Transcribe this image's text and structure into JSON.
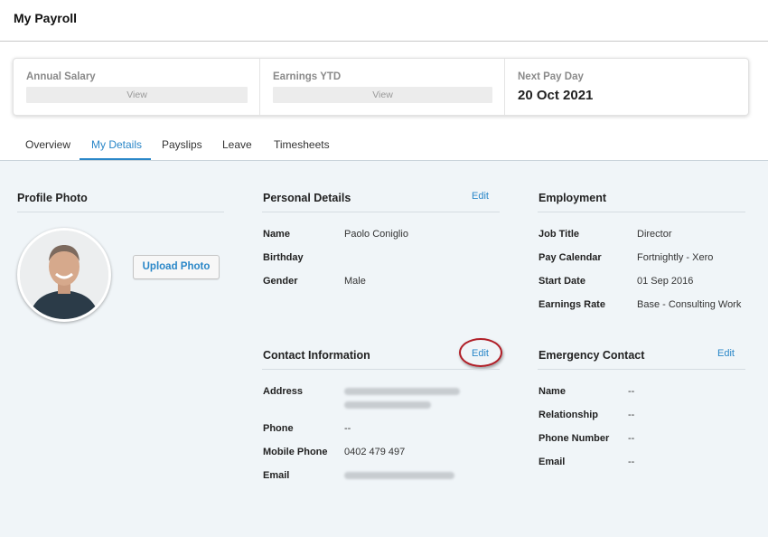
{
  "page_title": "My Payroll",
  "summary": {
    "annual_salary": {
      "label": "Annual Salary",
      "action": "View"
    },
    "earnings_ytd": {
      "label": "Earnings YTD",
      "action": "View"
    },
    "next_pay_day": {
      "label": "Next Pay Day",
      "value": "20 Oct 2021"
    }
  },
  "tabs": [
    {
      "label": "Overview"
    },
    {
      "label": "My Details"
    },
    {
      "label": "Payslips"
    },
    {
      "label": "Leave"
    },
    {
      "label": "Timesheets"
    }
  ],
  "active_tab": "My Details",
  "profile": {
    "title": "Profile Photo",
    "upload_label": "Upload Photo"
  },
  "personal": {
    "title": "Personal Details",
    "edit_label": "Edit",
    "rows": [
      {
        "label": "Name",
        "value": "Paolo Coniglio"
      },
      {
        "label": "Birthday",
        "value": ""
      },
      {
        "label": "Gender",
        "value": "Male"
      }
    ]
  },
  "employment": {
    "title": "Employment",
    "rows": [
      {
        "label": "Job Title",
        "value": "Director"
      },
      {
        "label": "Pay Calendar",
        "value": "Fortnightly - Xero"
      },
      {
        "label": "Start Date",
        "value": "01 Sep 2016"
      },
      {
        "label": "Earnings Rate",
        "value": "Base - Consulting Work"
      }
    ]
  },
  "contact": {
    "title": "Contact Information",
    "edit_label": "Edit",
    "rows": [
      {
        "label": "Address",
        "value": ""
      },
      {
        "label": "Phone",
        "value": "--"
      },
      {
        "label": "Mobile Phone",
        "value": "0402 479 497"
      },
      {
        "label": "Email",
        "value": ""
      }
    ]
  },
  "emergency": {
    "title": "Emergency Contact",
    "edit_label": "Edit",
    "rows": [
      {
        "label": "Name",
        "value": "--"
      },
      {
        "label": "Relationship",
        "value": "--"
      },
      {
        "label": "Phone Number",
        "value": "--"
      },
      {
        "label": "Email",
        "value": "--"
      }
    ]
  },
  "colors": {
    "accent": "#2a87c8",
    "highlight": "#b01e27",
    "background": "#f0f5f8"
  }
}
